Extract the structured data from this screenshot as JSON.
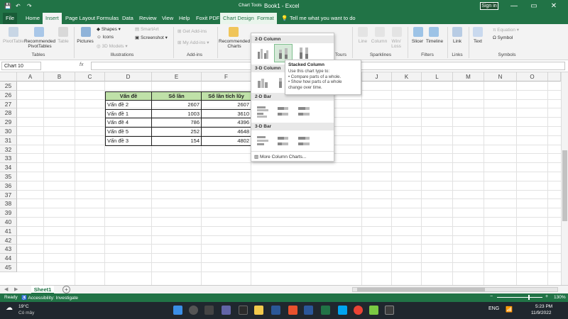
{
  "titlebar": {
    "title": "Book1 - Excel",
    "sign_in": "Sign in",
    "minimize": "—",
    "restore": "▭",
    "close": "✕"
  },
  "tabs": {
    "file": "File",
    "home": "Home",
    "insert": "Insert",
    "page_layout": "Page Layout",
    "formulas": "Formulas",
    "data": "Data",
    "review": "Review",
    "view": "View",
    "help": "Help",
    "foxit": "Foxit PDF",
    "chart_design": "Chart Design",
    "format": "Format",
    "tell_me": "Tell me what you want to do",
    "chart_tools": "Chart Tools"
  },
  "ribbon": {
    "pivottable": "PivotTable",
    "recommended_pivottables": "Recommended\nPivotTables",
    "table": "Table",
    "pictures": "Pictures",
    "shapes": "Shapes",
    "icons": "Icons",
    "models_3d": "3D Models",
    "smartart": "SmartArt",
    "screenshot": "Screenshot",
    "get_addins": "Get Add-ins",
    "my_addins": "My Add-ins",
    "recommended_charts": "Recommended\nCharts",
    "tours": "Tours",
    "line": "Line",
    "column": "Column",
    "win_loss": "Win/\nLoss",
    "slicer": "Slicer",
    "timeline": "Timeline",
    "link": "Link",
    "text": "Text",
    "equation": "Equation",
    "symbol": "Symbol",
    "groups": {
      "tables": "Tables",
      "illustrations": "Illustrations",
      "addins": "Add-ins",
      "tours": "Tours",
      "sparklines": "Sparklines",
      "filters": "Filters",
      "links": "Links",
      "symbols": "Symbols"
    }
  },
  "formula_bar": {
    "name_box": "Chart 10",
    "fx": "fx",
    "value": ""
  },
  "columns": [
    "A",
    "B",
    "C",
    "D",
    "E",
    "F",
    "J",
    "K",
    "L",
    "M",
    "N",
    "O"
  ],
  "rows": [
    "25",
    "26",
    "27",
    "28",
    "29",
    "30",
    "31",
    "32",
    "33",
    "34",
    "35",
    "36",
    "37",
    "38",
    "39",
    "40",
    "41",
    "42",
    "43",
    "44",
    "45"
  ],
  "table": {
    "headers": [
      "Vấn đề",
      "Số lần",
      "Số lần tích lũy"
    ],
    "rows": [
      [
        "Vấn đề 2",
        "2607",
        "2607"
      ],
      [
        "Vấn đề 1",
        "1003",
        "3610"
      ],
      [
        "Vấn đề 4",
        "786",
        "4396"
      ],
      [
        "Vấn đề 5",
        "252",
        "4648"
      ],
      [
        "Vấn đề 3",
        "154",
        "4802"
      ]
    ]
  },
  "dropdown": {
    "sec_2d_column": "2-D Column",
    "sec_3d_column": "3-D Column",
    "sec_2d_bar": "2-D Bar",
    "sec_3d_bar": "3-D Bar",
    "more": "More Column Charts..."
  },
  "tooltip": {
    "title": "Stacked Column",
    "line1": "Use this chart type to:",
    "line2": "• Compare parts of a whole.",
    "line3": "• Show how parts of a whole",
    "line4": "change over time."
  },
  "sheet": {
    "tab": "Sheet1",
    "add": "+"
  },
  "status": {
    "ready": "Ready",
    "accessibility": "Accessibility: Investigate",
    "zoom": "130%"
  },
  "taskbar": {
    "temp": "19°C",
    "weather": "Có mây",
    "lang": "ENG",
    "time": "5:23 PM",
    "date": "11/9/2022"
  },
  "colors": {
    "excel_green": "#217346",
    "table_header": "#bfe1a8"
  }
}
